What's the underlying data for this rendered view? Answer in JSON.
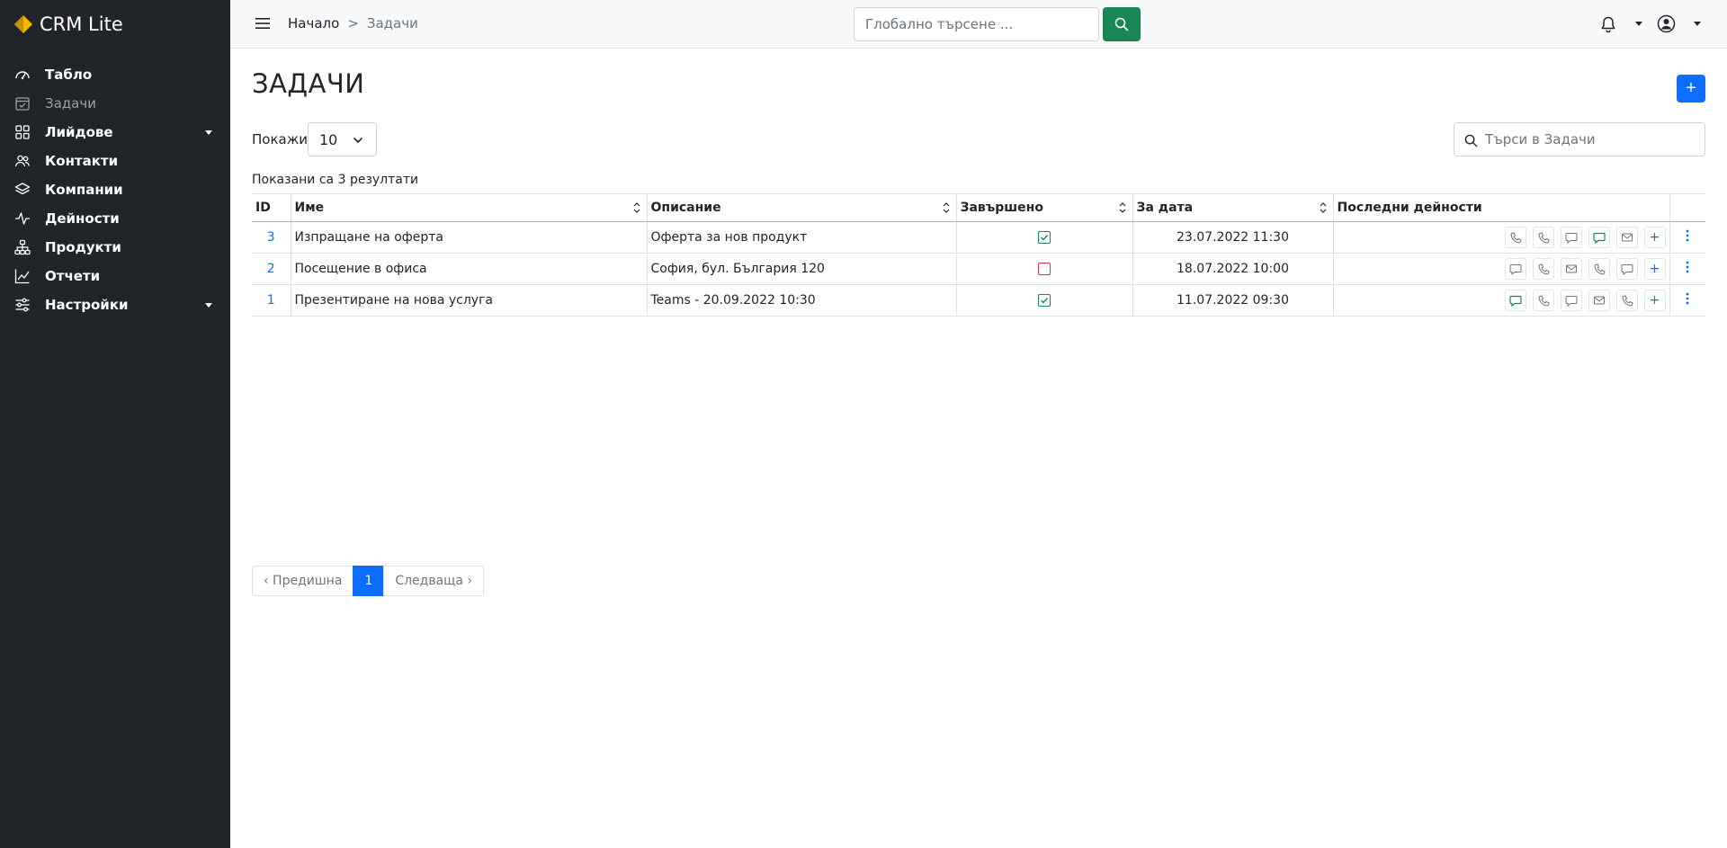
{
  "app": {
    "name": "CRM Lite"
  },
  "sidebar": {
    "items": [
      {
        "label": "Табло",
        "icon": "speedometer-icon"
      },
      {
        "label": "Задачи",
        "icon": "calendar-check-icon",
        "active": true
      },
      {
        "label": "Лийдове",
        "icon": "grid-icon",
        "has_caret": true
      },
      {
        "label": "Контакти",
        "icon": "people-icon"
      },
      {
        "label": "Компании",
        "icon": "layers-icon"
      },
      {
        "label": "Дейности",
        "icon": "activity-icon"
      },
      {
        "label": "Продукти",
        "icon": "diagram-icon"
      },
      {
        "label": "Отчети",
        "icon": "graph-up-icon"
      },
      {
        "label": "Настройки",
        "icon": "sliders-icon",
        "has_caret": true
      }
    ]
  },
  "topbar": {
    "breadcrumb": {
      "home": "Начало",
      "separator": ">",
      "current": "Задачи"
    },
    "search_placeholder": "Глобално търсене ...",
    "accent": "#198754"
  },
  "main": {
    "title": "ЗАДАЧИ",
    "add_label": "+",
    "show_label": "Покажи",
    "page_size": "10",
    "search_placeholder": "Търси в Задачи",
    "results_text": "Показани са 3 резултати"
  },
  "table": {
    "columns": [
      "ID",
      "Име",
      "Описание",
      "Завършено",
      "За дата",
      "Последни дейности"
    ],
    "rows": [
      {
        "id": "3",
        "name": "Изпращане на оферта",
        "description": "Оферта за нов продукт",
        "done": true,
        "date": "23.07.2022 11:30",
        "activities": [
          "phone",
          "phone",
          "chat",
          "chat-green",
          "mail",
          "plus"
        ]
      },
      {
        "id": "2",
        "name": "Посещение в офиса",
        "description": "София, бул. България 120",
        "done": false,
        "date": "18.07.2022 10:00",
        "activities": [
          "chat",
          "phone",
          "mail",
          "phone",
          "chat",
          "plus"
        ]
      },
      {
        "id": "1",
        "name": "Презентиране на нова услуга",
        "description": "Teams - 20.09.2022 10:30",
        "done": true,
        "date": "11.07.2022 09:30",
        "activities": [
          "chat-green",
          "phone",
          "chat",
          "mail",
          "phone",
          "plus"
        ]
      }
    ]
  },
  "pagination": {
    "prev": "‹ Предишна",
    "page": "1",
    "next": "Следваща ›"
  },
  "colors": {
    "primary": "#0d6efd",
    "success": "#198754",
    "danger": "#dc3545",
    "sidebar": "#212529"
  }
}
